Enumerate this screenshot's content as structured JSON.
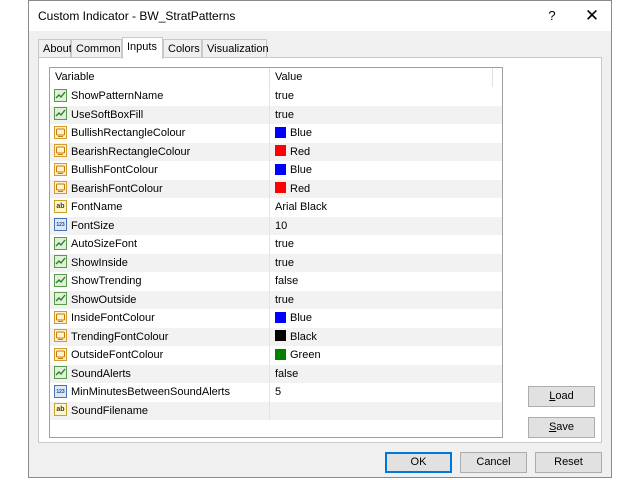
{
  "window": {
    "title": "Custom Indicator - BW_StratPatterns",
    "help": "?",
    "close": "✕"
  },
  "tabs": [
    {
      "label": "About"
    },
    {
      "label": "Common"
    },
    {
      "label": "Inputs"
    },
    {
      "label": "Colors"
    },
    {
      "label": "Visualization"
    }
  ],
  "active_tab": "Inputs",
  "grid": {
    "headers": {
      "variable": "Variable",
      "value": "Value"
    },
    "rows": [
      {
        "type": "bool",
        "icon": "bool-icon",
        "name": "ShowPatternName",
        "value": "true"
      },
      {
        "type": "bool",
        "icon": "bool-icon",
        "name": "UseSoftBoxFill",
        "value": "true"
      },
      {
        "type": "color",
        "icon": "color-icon",
        "name": "BullishRectangleColour",
        "value": "Blue",
        "swatch": "#0000ff"
      },
      {
        "type": "color",
        "icon": "color-icon",
        "name": "BearishRectangleColour",
        "value": "Red",
        "swatch": "#ff0000"
      },
      {
        "type": "color",
        "icon": "color-icon",
        "name": "BullishFontColour",
        "value": "Blue",
        "swatch": "#0000ff"
      },
      {
        "type": "color",
        "icon": "color-icon",
        "name": "BearishFontColour",
        "value": "Red",
        "swatch": "#ff0000"
      },
      {
        "type": "string",
        "icon": "string-icon",
        "name": "FontName",
        "value": "Arial Black"
      },
      {
        "type": "int",
        "icon": "int-icon",
        "name": "FontSize",
        "value": "10"
      },
      {
        "type": "bool",
        "icon": "bool-icon",
        "name": "AutoSizeFont",
        "value": "true"
      },
      {
        "type": "bool",
        "icon": "bool-icon",
        "name": "ShowInside",
        "value": "true"
      },
      {
        "type": "bool",
        "icon": "bool-icon",
        "name": "ShowTrending",
        "value": "false"
      },
      {
        "type": "bool",
        "icon": "bool-icon",
        "name": "ShowOutside",
        "value": "true"
      },
      {
        "type": "color",
        "icon": "color-icon",
        "name": "InsideFontColour",
        "value": "Blue",
        "swatch": "#0000ff"
      },
      {
        "type": "color",
        "icon": "color-icon",
        "name": "TrendingFontColour",
        "value": "Black",
        "swatch": "#000000"
      },
      {
        "type": "color",
        "icon": "color-icon",
        "name": "OutsideFontColour",
        "value": "Green",
        "swatch": "#008000"
      },
      {
        "type": "bool",
        "icon": "bool-icon",
        "name": "SoundAlerts",
        "value": "false"
      },
      {
        "type": "int",
        "icon": "int-icon",
        "name": "MinMinutesBetweenSoundAlerts",
        "value": "5"
      },
      {
        "type": "string",
        "icon": "string-icon",
        "name": "SoundFilename",
        "value": ""
      }
    ]
  },
  "side_buttons": {
    "load": "Load",
    "save": "Save"
  },
  "footer_buttons": {
    "ok": "OK",
    "cancel": "Cancel",
    "reset": "Reset"
  },
  "icon_text": {
    "string": "ab",
    "int": "123"
  }
}
